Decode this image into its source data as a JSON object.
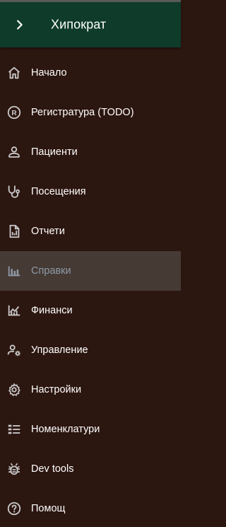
{
  "app": {
    "title": "Хипократ",
    "colors": {
      "header_bg": "#0e3b2a",
      "sidebar_bg": "#2c1610",
      "active_bg": "#463a35",
      "icon": "#c9c9c9",
      "active_text": "#8e9aa6"
    }
  },
  "header": {
    "toggle_icon": "chevron-right-icon",
    "title": "Хипократ"
  },
  "nav": {
    "items": [
      {
        "label": "Начало",
        "icon": "home-icon"
      },
      {
        "label": "Регистратура (TODO)",
        "icon": "registered-icon"
      },
      {
        "label": "Пациенти",
        "icon": "person-icon"
      },
      {
        "label": "Посещения",
        "icon": "stethoscope-icon"
      },
      {
        "label": "Отчети",
        "icon": "report-icon"
      },
      {
        "label": "Справки",
        "icon": "bar-chart-icon",
        "active": true
      },
      {
        "label": "Финанси",
        "icon": "finance-chart-icon"
      },
      {
        "label": "Управление",
        "icon": "manage-accounts-icon"
      },
      {
        "label": "Настройки",
        "icon": "gear-icon"
      },
      {
        "label": "Номенклатури",
        "icon": "list-icon"
      },
      {
        "label": "Dev tools",
        "icon": "bug-icon"
      },
      {
        "label": "Помощ",
        "icon": "help-icon"
      }
    ]
  }
}
